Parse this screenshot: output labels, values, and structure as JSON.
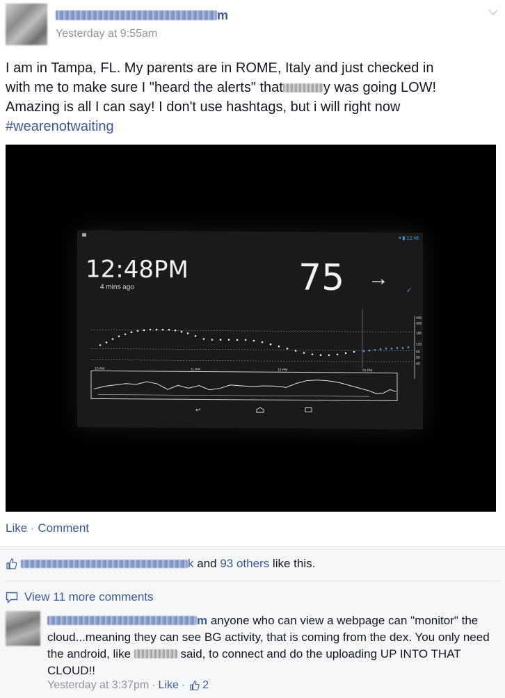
{
  "post": {
    "author_suffix": "m",
    "timestamp": "Yesterday at 9:55am",
    "text_line1": "I am in Tampa, FL. My parents are in ROME, Italy and just checked in",
    "text_line2a": "with me to make sure I \"heard the alerts\" that",
    "text_line2b": "y was going LOW!",
    "text_line3": "Amazing is all I can say! I don't use hashtags, but i will right now",
    "hashtag": "#wearenotwaiting"
  },
  "photo": {
    "screen_time": "12:48PM",
    "status_clock": "12:48",
    "minutes_ago": "4 mins ago",
    "bg_value": "75",
    "trend_arrow": "→",
    "check_mark": "✓",
    "x_labels": [
      "10 AM",
      "11 AM",
      "12 PM",
      "01 PM"
    ],
    "y_labels": [
      "400",
      "300",
      "180",
      "120",
      "80",
      "60",
      "40"
    ]
  },
  "actions": {
    "like": "Like",
    "separator": "·",
    "comment": "Comment"
  },
  "likes": {
    "name_suffix": "k",
    "text_and": " and ",
    "others": "93 others",
    "text_like_this": " like this."
  },
  "comments": {
    "view_more": "View 11 more comments",
    "items": [
      {
        "author_suffix": "m",
        "text_a": " anyone who can view a webpage can \"monitor\" the cloud...meaning they can see BG activity, that is coming from the dex. You only need the android, like ",
        "text_b": " said, to connect and do the uploading UP INTO THAT CLOUD!!",
        "timestamp": "Yesterday at 3:37pm",
        "separator": "·",
        "like": "Like",
        "like_count": "2"
      }
    ]
  },
  "colors": {
    "link_blue": "#3b5998",
    "meta_gray": "#90949c",
    "screen_blue": "#3fa7e0"
  }
}
